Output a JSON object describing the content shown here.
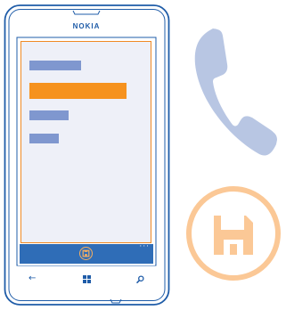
{
  "device": {
    "brand_label": "NOKIA",
    "colors": {
      "outline": "#1f5ca8",
      "accent": "#f6921e",
      "screen_bg": "#eef0f8",
      "list_item": "#7f97cf",
      "app_bar": "#2f6db7",
      "call_icon": "#b8c6e3",
      "save_icon_circle": "#fbc896"
    },
    "app_bar": {
      "more_glyph": "···",
      "button_icon": "save-icon"
    },
    "hardware_keys": {
      "back_glyph": "←",
      "start_icon": "windows-logo-icon",
      "search_glyph": "⚲"
    }
  },
  "illustrations": {
    "right_top": "phone-handset-icon",
    "right_bottom": "floppy-disk-save-icon"
  }
}
